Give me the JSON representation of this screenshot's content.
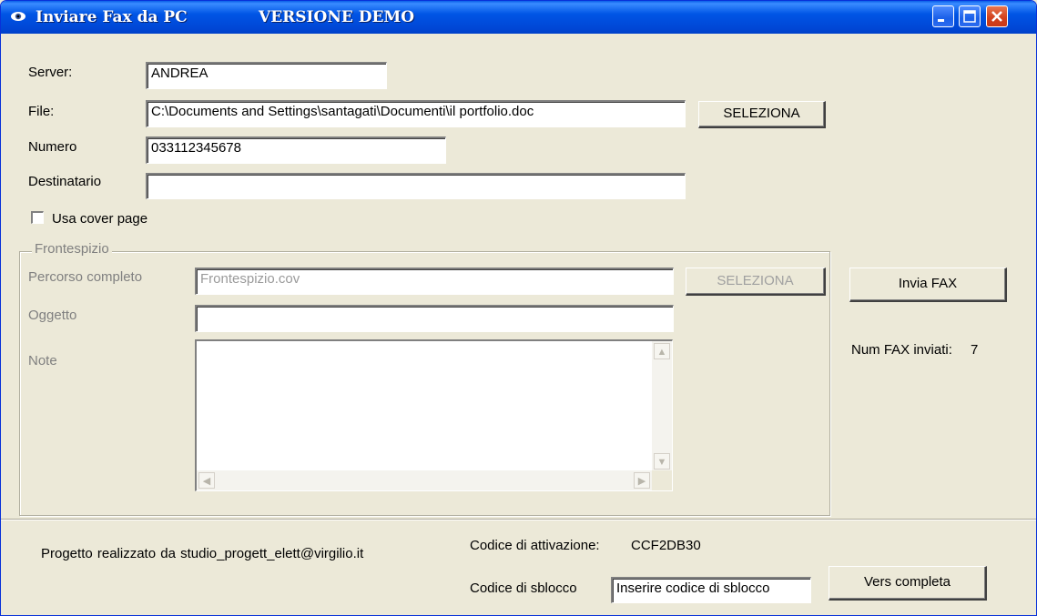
{
  "window": {
    "title": "Inviare Fax da PC",
    "demo_label": "VERSIONE DEMO"
  },
  "form": {
    "server_label": "Server:",
    "server_value": "ANDREA",
    "file_label": "File:",
    "file_value": "C:\\Documents and Settings\\santagati\\Documenti\\il portfolio.doc",
    "file_select_button": "SELEZIONA",
    "numero_label": "Numero",
    "numero_value": "033112345678",
    "destinatario_label": "Destinatario",
    "destinatario_value": "",
    "cover_checkbox_label": "Usa cover page",
    "cover_checked": false
  },
  "frontespizio": {
    "group_title": "Frontespizio",
    "percorso_label": "Percorso completo",
    "percorso_value": "Frontespizio.cov",
    "select_button": "SELEZIONA",
    "oggetto_label": "Oggetto",
    "oggetto_value": "",
    "note_label": "Note",
    "note_value": ""
  },
  "side": {
    "send_button": "Invia FAX",
    "sent_count_label": "Num FAX inviati:",
    "sent_count_value": "7"
  },
  "footer": {
    "credits": "Progetto  realizzato  da  studio_progett_elett@virgilio.it",
    "activation_label": "Codice di attivazione:",
    "activation_value": "CCF2DB30",
    "unlock_label": "Codice di sblocco",
    "unlock_value": "Inserire codice di sblocco",
    "full_version_button": "Vers completa"
  },
  "colors": {
    "titlebar": "#0055E5",
    "face": "#ECE9D8",
    "disabled_text": "#808080"
  }
}
